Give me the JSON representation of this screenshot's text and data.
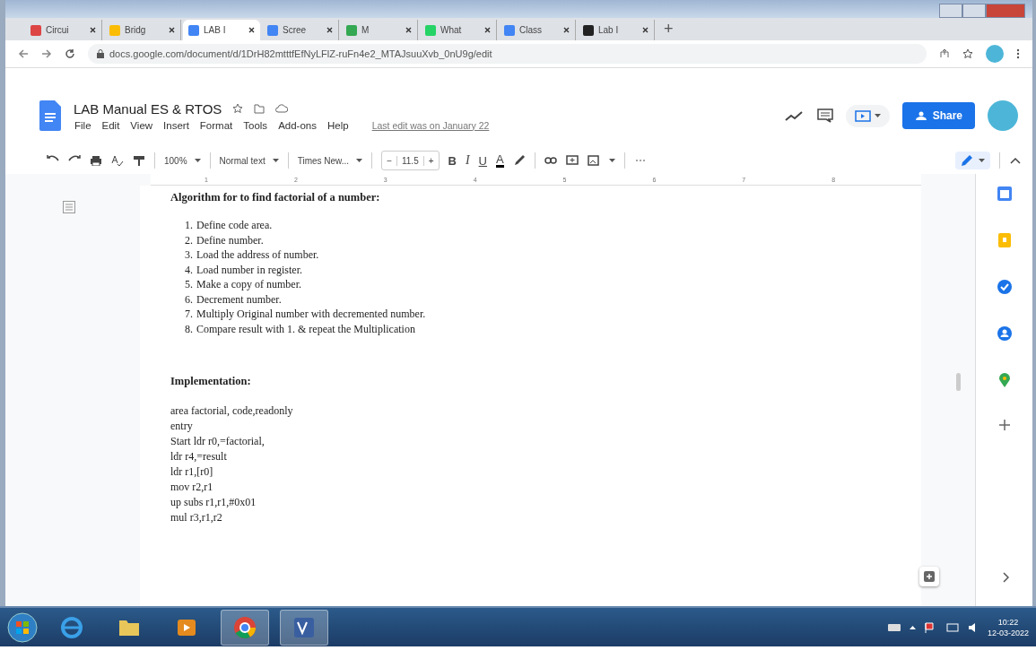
{
  "browser": {
    "tabs": [
      {
        "title": "Circui",
        "selected": false
      },
      {
        "title": "Bridg",
        "selected": false
      },
      {
        "title": "LAB I",
        "selected": true
      },
      {
        "title": "Scree",
        "selected": false
      },
      {
        "title": "M",
        "selected": false
      },
      {
        "title": "What",
        "selected": false
      },
      {
        "title": "Class",
        "selected": false
      },
      {
        "title": "Lab I",
        "selected": false
      }
    ],
    "new_tab": "+",
    "url": "docs.google.com/document/d/1DrH82mtttfEfNyLFlZ-ruFn4e2_MTAJsuuXvb_0nU9g/edit"
  },
  "doc_header": {
    "title": "LAB Manual ES & RTOS",
    "menu": [
      "File",
      "Edit",
      "View",
      "Insert",
      "Format",
      "Tools",
      "Add-ons",
      "Help"
    ],
    "last_edit": "Last edit was on January 22",
    "share": "Share"
  },
  "toolbar": {
    "zoom": "100%",
    "style": "Normal text",
    "font": "Times New...",
    "size_minus": "−",
    "font_size": "11.5",
    "size_plus": "+",
    "bold": "B",
    "italic": "I",
    "underline": "U",
    "text_color": "A"
  },
  "ruler": [
    "1",
    "2",
    "3",
    "4",
    "5",
    "6",
    "7",
    "8"
  ],
  "document": {
    "heading": "Algorithm for to find factorial of a number:",
    "steps": [
      {
        "number": "1.",
        "text": "Define code area."
      },
      {
        "number": "2.",
        "text": "Define number."
      },
      {
        "number": "3.",
        "text": "Load the address of number."
      },
      {
        "number": "4.",
        "text": "Load number in register."
      },
      {
        "number": "5.",
        "text": "Make a copy of number."
      },
      {
        "number": "6.",
        "text": "Decrement number."
      },
      {
        "number": "7.",
        "text": "Multiply Original number with decremented number."
      },
      {
        "number": "8.",
        "text": "Compare result with 1. & repeat the Multiplication"
      }
    ],
    "section": "Implementation:",
    "code": [
      "area factorial, code,readonly",
      "entry",
      "Start ldr r0,=factorial,",
      "ldr r4,=result",
      "ldr r1,[r0]",
      "mov r2,r1",
      "up subs r1,r1,#0x01",
      "mul r3,r1,r2"
    ]
  },
  "taskbar": {
    "apps": [
      {
        "kind": "ie",
        "selected": false
      },
      {
        "kind": "folder",
        "selected": false
      },
      {
        "kind": "media",
        "selected": false
      },
      {
        "kind": "chrome",
        "selected": true
      },
      {
        "kind": "app",
        "selected": true
      }
    ],
    "time": "10:22",
    "date": "12-03-2022"
  }
}
